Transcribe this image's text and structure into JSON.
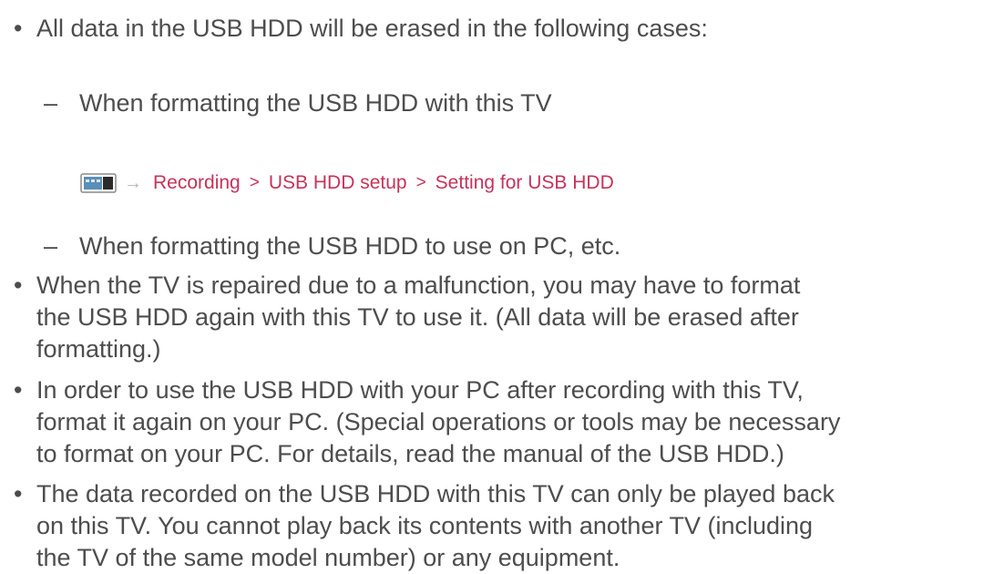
{
  "colors": {
    "text": "#4d4d4d",
    "link": "#c8325a"
  },
  "bullets": [
    {
      "lines": [
        "All data in the USB HDD will be erased in the following cases:"
      ]
    },
    {
      "lines": [
        "When the TV is repaired due to a malfunction, you may have to format",
        "the USB HDD again with this TV to use it. (All data will be erased after",
        "formatting.)"
      ]
    },
    {
      "lines": [
        "In order to use the USB HDD with your PC after recording with this TV,",
        "format it again on your PC. (Special operations or tools may be necessary",
        "to format on your PC. For details, read the manual of the USB HDD.)"
      ]
    },
    {
      "lines": [
        "The data recorded on the USB HDD with this TV can only be played back",
        "on this TV. You cannot play back its contents with another TV (including",
        "the TV of the same model number) or any equipment."
      ]
    }
  ],
  "sub_items": [
    "When formatting the USB HDD with this TV",
    "When formatting the USB HDD to use on PC, etc."
  ],
  "menu_path": {
    "icon": "menu-icon",
    "arrow": "→",
    "separator": ">",
    "steps": [
      "Recording",
      "USB HDD setup",
      "Setting for USB HDD"
    ]
  }
}
